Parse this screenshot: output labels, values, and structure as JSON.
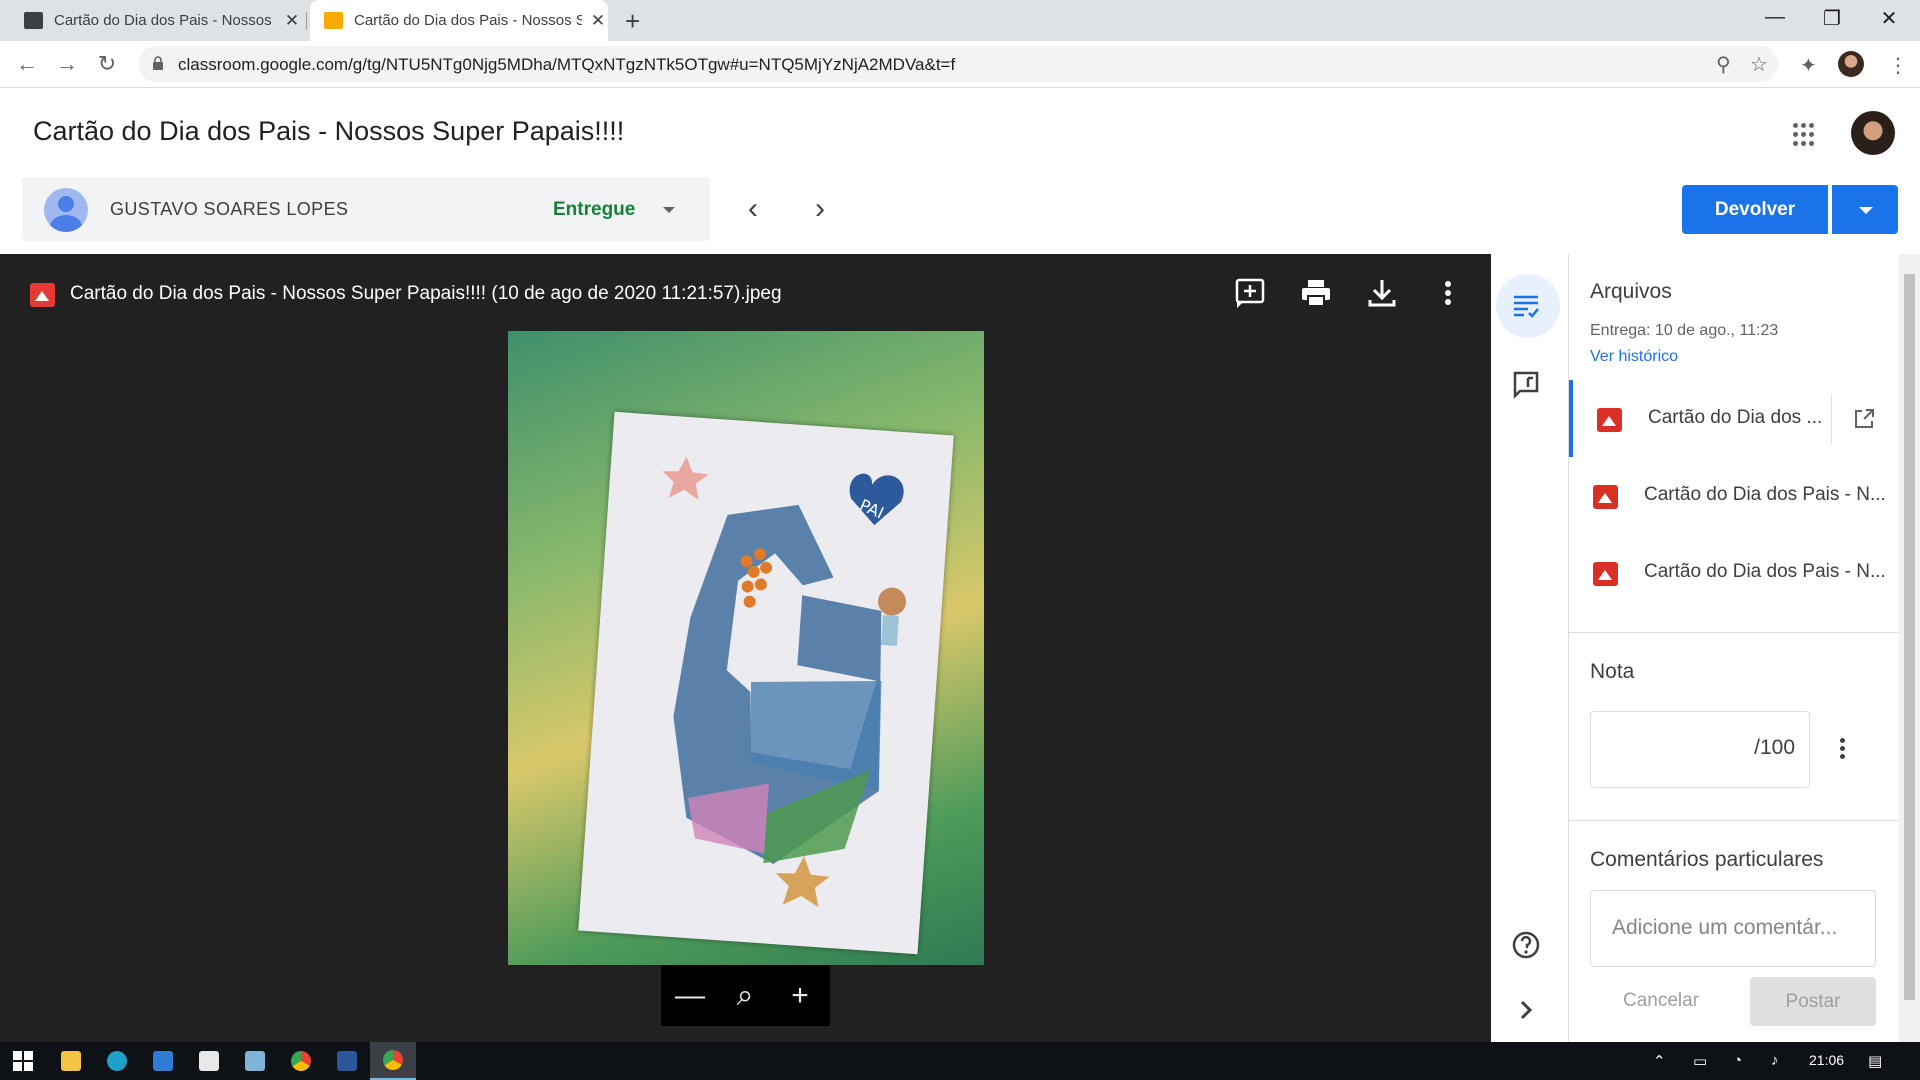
{
  "browser": {
    "tabs": [
      {
        "title": "Cartão do Dia dos Pais - Nossos Super Papais!!!!",
        "active": false,
        "favicon_color": "#3c4043"
      },
      {
        "title": "Cartão do Dia dos Pais - Nossos Super Papais!!!!",
        "active": true,
        "favicon_color": "#f9ab00"
      }
    ],
    "new_tab_label": "+",
    "url": "classroom.google.com/g/tg/NTU5NTg0Njg5MDha/MTQxNTgzNTk5OTgw#u=NTQ5MjYzNjA2MDVa&t=f",
    "window_controls": {
      "minimize": "—",
      "maximize": "❐",
      "close": "✕"
    }
  },
  "header": {
    "title": "Cartão do Dia dos Pais - Nossos Super Papais!!!!",
    "student_name": "GUSTAVO SOARES LOPES",
    "status": "Entregue",
    "prev_icon": "‹",
    "next_icon": "›",
    "return_button": "Devolver",
    "accent_color": "#1a73e8"
  },
  "viewer": {
    "file_title": "Cartão do Dia dos Pais - Nossos Super Papais!!!! (10 de ago de 2020 11:21:57).jpeg",
    "tools": [
      "add-comment-icon",
      "print-icon",
      "download-icon",
      "more-vert-icon"
    ],
    "zoom": {
      "out": "—",
      "fit": "⌕",
      "in": "+"
    },
    "image_description_icon": "image-icon"
  },
  "panel": {
    "files_heading": "Arquivos",
    "submitted": "Entrega: 10 de ago., 11:23",
    "history_link": "Ver histórico",
    "files": [
      {
        "name": "Cartão do Dia dos ...",
        "active": true
      },
      {
        "name": "Cartão do Dia dos Pais - N...",
        "active": false
      },
      {
        "name": "Cartão do Dia dos Pais - N...",
        "active": false
      }
    ],
    "grade_heading": "Nota",
    "grade_value": "/100",
    "comments_heading": "Comentários particulares",
    "comment_placeholder": "Adicione um comentár...",
    "cancel": "Cancelar",
    "post": "Postar"
  },
  "taskbar": {
    "time": "21:06",
    "apps": [
      "windows-start-icon",
      "file-explorer-icon",
      "edge-icon",
      "mail-icon",
      "store-icon",
      "app-icon",
      "chrome-icon",
      "word-icon",
      "chrome-profile-icon"
    ]
  }
}
